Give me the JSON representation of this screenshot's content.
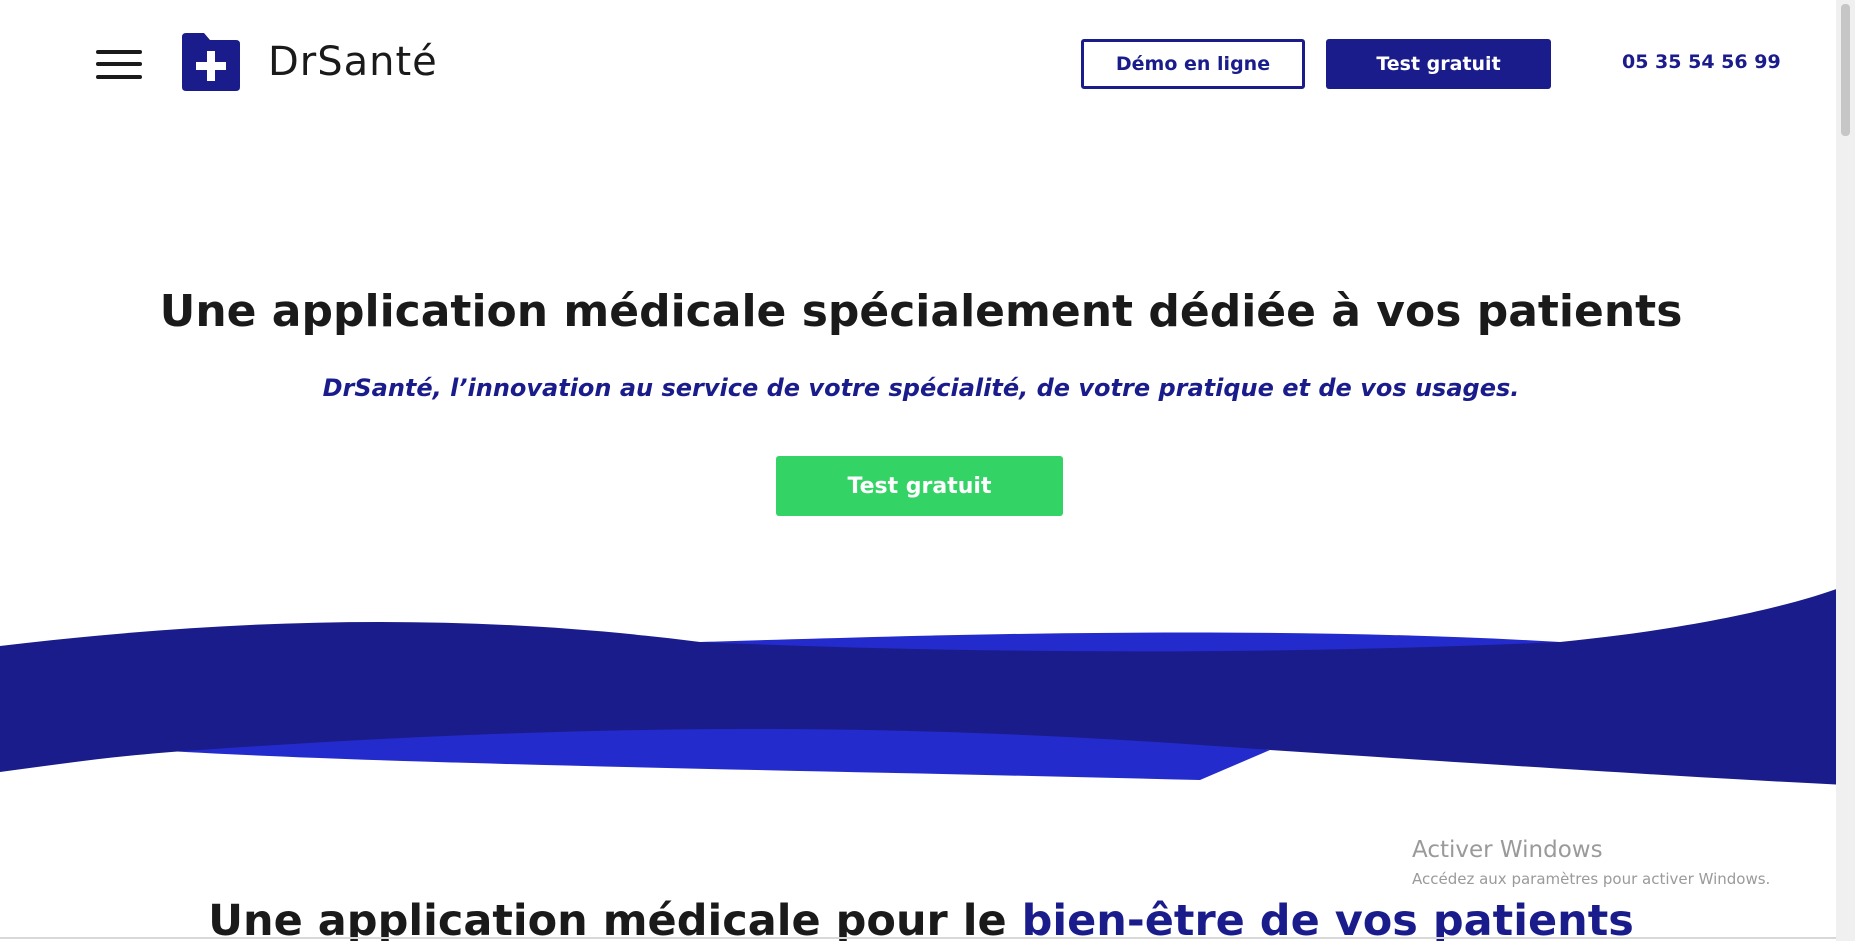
{
  "header": {
    "brand_name": "DrSanté",
    "logo_icon": "medical-folder-plus-icon",
    "menu_icon": "hamburger-menu-icon",
    "demo_button_label": "Démo en ligne",
    "trial_button_label": "Test gratuit",
    "phone_number": "05 35 54 56 99"
  },
  "hero": {
    "title": "Une application médicale spécialement dédiée à vos patients",
    "subtitle": "DrSanté, l’innovation au service de votre spécialité, de votre pratique et de vos usages.",
    "cta_label": "Test gratuit"
  },
  "section": {
    "title_part1": "Une application médicale pour le ",
    "title_part2": "bien-être de vos patients"
  },
  "watermark": {
    "title": "Activer Windows",
    "subtitle": "Accédez aux paramètres pour activer Windows."
  },
  "colors": {
    "brand_navy": "#1a1c8c",
    "wave_light_blue": "#242bcc",
    "cta_green": "#33d465",
    "text_dark": "#1a1a1a"
  }
}
